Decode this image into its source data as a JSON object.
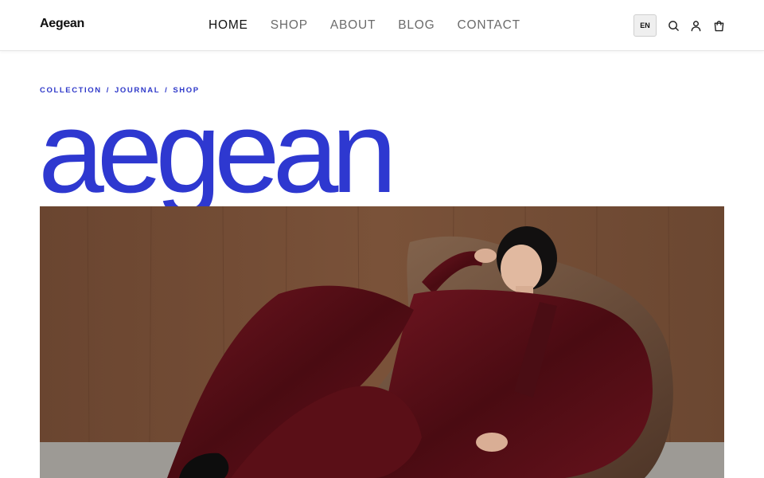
{
  "header": {
    "logo": "Aegean",
    "nav": [
      {
        "label": "HOME",
        "active": true
      },
      {
        "label": "SHOP",
        "active": false
      },
      {
        "label": "ABOUT",
        "active": false
      },
      {
        "label": "BLOG",
        "active": false
      },
      {
        "label": "CONTACT",
        "active": false
      }
    ],
    "language": "EN",
    "icons": [
      "search-icon",
      "user-icon",
      "cart-icon"
    ]
  },
  "breadcrumb": [
    "COLLECTION",
    "JOURNAL",
    "SHOP"
  ],
  "hero": {
    "title": "aegean",
    "image": "model in burgundy velvet suit reclining in leather bean bag chair"
  },
  "colors": {
    "accent": "#2e38d0",
    "nav_active": "#111111",
    "nav_inactive": "#6b6b6b",
    "velvet": "#5a0f17",
    "wood_wall": "#6e4a34"
  }
}
